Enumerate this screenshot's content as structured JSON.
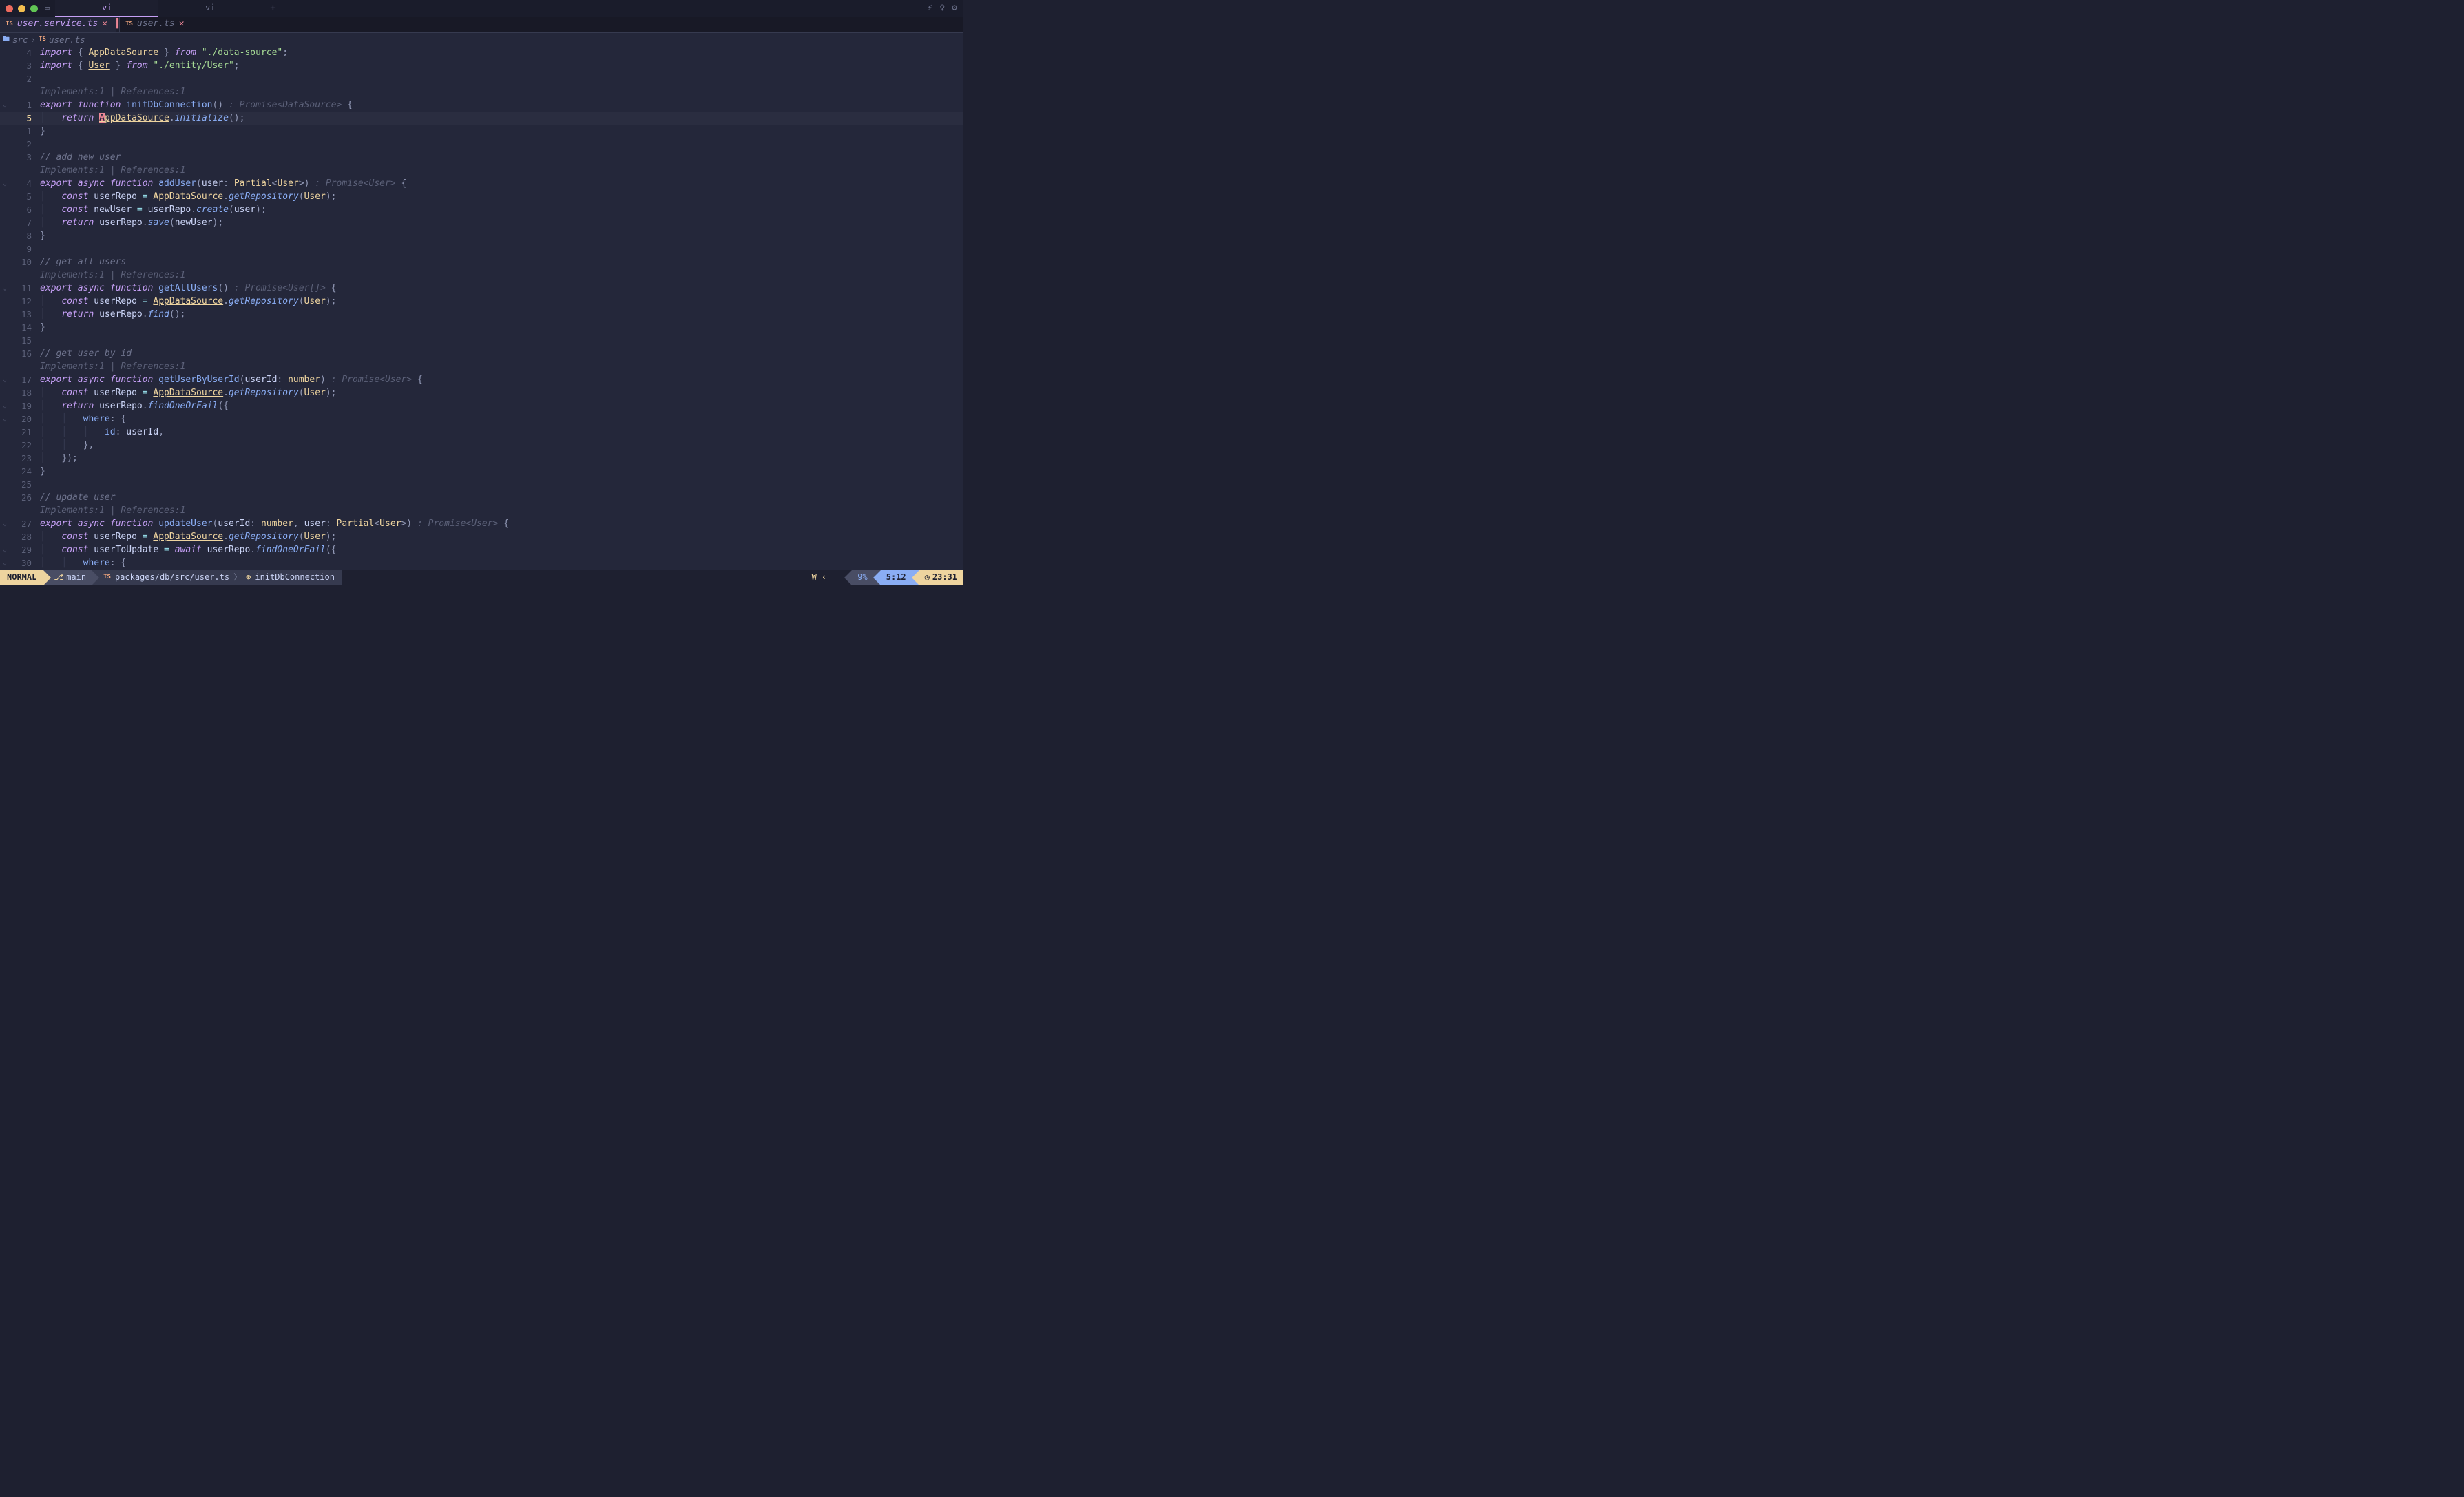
{
  "os": {
    "tabs": [
      {
        "label": "vi",
        "active": true
      },
      {
        "label": "vi",
        "active": false
      }
    ]
  },
  "ed_tabs": [
    {
      "index": "TS",
      "label": "user.service.ts",
      "close": "✕",
      "active": true,
      "cursor": true
    },
    {
      "index": "TS",
      "label": "user.ts",
      "close": "✕",
      "active": false
    }
  ],
  "winbar": {
    "root": "src",
    "file": "user.ts",
    "ts_badge": "TS"
  },
  "codelens_text": "Implements:1 | References:1",
  "code": {
    "lines": [
      {
        "g": "4",
        "fold": "",
        "html": "<span class='kw'>import</span> <span class='punct'>{</span> <span class='typeul'>AppDataSource</span> <span class='punct'>}</span> <span class='kw'>from</span> <span class='str'>\"./data-source\"</span><span class='punct'>;</span>"
      },
      {
        "g": "3",
        "fold": "",
        "html": "<span class='kw'>import</span> <span class='punct'>{</span> <span class='typeul'>User</span> <span class='punct'>}</span> <span class='kw'>from</span> <span class='str'>\"./entity/User\"</span><span class='punct'>;</span>"
      },
      {
        "g": "2",
        "fold": "",
        "html": ""
      },
      {
        "g": "",
        "fold": "",
        "html": "<span class='codelens'>Implements:1 | References:1</span>"
      },
      {
        "g": "1",
        "fold": "⌄",
        "html": "<span class='kw'>export</span> <span class='kw'>function</span> <span class='fn'>initDbConnection</span><span class='punct'>()</span> <span class='hint'>: Promise&lt;DataSource&gt;</span> <span class='punct'>{</span>"
      },
      {
        "g": "5",
        "fold": "",
        "cur": true,
        "html": "<span class='indent-guide'>│</span>   <span class='kw'>return</span> <span class='typeul'><span class='cursor-hl'>A</span>ppDataSource</span><span class='punct'>.</span><span class='fncall'>initialize</span><span class='punct'>();</span>"
      },
      {
        "g": "1",
        "fold": "",
        "html": "<span class='punct'>}</span>"
      },
      {
        "g": "2",
        "fold": "",
        "html": ""
      },
      {
        "g": "3",
        "fold": "",
        "html": "<span class='cmt'>// add new user</span>"
      },
      {
        "g": "",
        "fold": "",
        "html": "<span class='codelens'>Implements:1 | References:1</span>"
      },
      {
        "g": "4",
        "fold": "⌄",
        "html": "<span class='kw'>export</span> <span class='kw'>async</span> <span class='kw'>function</span> <span class='fn'>addUser</span><span class='punct'>(</span><span class='param'>user</span><span class='punct'>:</span> <span class='type'>Partial</span><span class='punct'>&lt;</span><span class='type'>User</span><span class='punct'>&gt;)</span> <span class='hint'>: Promise&lt;User&gt;</span> <span class='punct'>{</span>"
      },
      {
        "g": "5",
        "fold": "",
        "html": "<span class='indent-guide'>│</span>   <span class='kw'>const</span> <span class='ident'>userRepo</span> <span class='op'>=</span> <span class='typeul'>AppDataSource</span><span class='punct'>.</span><span class='fncall'>getRepository</span><span class='punct'>(</span><span class='type'>User</span><span class='punct'>);</span>"
      },
      {
        "g": "6",
        "fold": "",
        "html": "<span class='indent-guide'>│</span>   <span class='kw'>const</span> <span class='ident'>newUser</span> <span class='op'>=</span> <span class='ident'>userRepo</span><span class='punct'>.</span><span class='fncall'>create</span><span class='punct'>(</span><span class='ident'>user</span><span class='punct'>);</span>"
      },
      {
        "g": "7",
        "fold": "",
        "html": "<span class='indent-guide'>│</span>   <span class='kw'>return</span> <span class='ident'>userRepo</span><span class='punct'>.</span><span class='fncall'>save</span><span class='punct'>(</span><span class='ident'>newUser</span><span class='punct'>);</span>"
      },
      {
        "g": "8",
        "fold": "",
        "html": "<span class='punct'>}</span>"
      },
      {
        "g": "9",
        "fold": "",
        "html": ""
      },
      {
        "g": "10",
        "fold": "",
        "html": "<span class='cmt'>// get all users</span>"
      },
      {
        "g": "",
        "fold": "",
        "html": "<span class='codelens'>Implements:1 | References:1</span>"
      },
      {
        "g": "11",
        "fold": "⌄",
        "html": "<span class='kw'>export</span> <span class='kw'>async</span> <span class='kw'>function</span> <span class='fn'>getAllUsers</span><span class='punct'>()</span> <span class='hint'>: Promise&lt;User[]&gt;</span> <span class='punct'>{</span>"
      },
      {
        "g": "12",
        "fold": "",
        "html": "<span class='indent-guide'>│</span>   <span class='kw'>const</span> <span class='ident'>userRepo</span> <span class='op'>=</span> <span class='typeul'>AppDataSource</span><span class='punct'>.</span><span class='fncall'>getRepository</span><span class='punct'>(</span><span class='type'>User</span><span class='punct'>);</span>"
      },
      {
        "g": "13",
        "fold": "",
        "html": "<span class='indent-guide'>│</span>   <span class='kw'>return</span> <span class='ident'>userRepo</span><span class='punct'>.</span><span class='fncall'>find</span><span class='punct'>();</span>"
      },
      {
        "g": "14",
        "fold": "",
        "html": "<span class='punct'>}</span>"
      },
      {
        "g": "15",
        "fold": "",
        "html": ""
      },
      {
        "g": "16",
        "fold": "",
        "html": "<span class='cmt'>// get user by id</span>"
      },
      {
        "g": "",
        "fold": "",
        "html": "<span class='codelens'>Implements:1 | References:1</span>"
      },
      {
        "g": "17",
        "fold": "⌄",
        "html": "<span class='kw'>export</span> <span class='kw'>async</span> <span class='kw'>function</span> <span class='fn'>getUserByUserId</span><span class='punct'>(</span><span class='param'>userId</span><span class='punct'>:</span> <span class='type'>number</span><span class='punct'>)</span> <span class='hint'>: Promise&lt;User&gt;</span> <span class='punct'>{</span>"
      },
      {
        "g": "18",
        "fold": "",
        "html": "<span class='indent-guide'>│</span>   <span class='kw'>const</span> <span class='ident'>userRepo</span> <span class='op'>=</span> <span class='typeul'>AppDataSource</span><span class='punct'>.</span><span class='fncall'>getRepository</span><span class='punct'>(</span><span class='type'>User</span><span class='punct'>);</span>"
      },
      {
        "g": "19",
        "fold": "⌄",
        "html": "<span class='indent-guide'>│</span>   <span class='kw'>return</span> <span class='ident'>userRepo</span><span class='punct'>.</span><span class='fncall'>findOneOrFail</span><span class='punct'>({</span>"
      },
      {
        "g": "20",
        "fold": "⌄",
        "html": "<span class='indent-guide'>│</span>   <span class='indent-guide'>│</span>   <span class='prop'>where</span><span class='punct'>:</span> <span class='punct'>{</span>"
      },
      {
        "g": "21",
        "fold": "",
        "html": "<span class='indent-guide'>│</span>   <span class='indent-guide'>│</span>   <span class='indent-guide'>│</span>   <span class='prop'>id</span><span class='punct'>:</span> <span class='ident'>userId</span><span class='punct'>,</span>"
      },
      {
        "g": "22",
        "fold": "",
        "html": "<span class='indent-guide'>│</span>   <span class='indent-guide'>│</span>   <span class='punct'>},</span>"
      },
      {
        "g": "23",
        "fold": "",
        "html": "<span class='indent-guide'>│</span>   <span class='punct'>});</span>"
      },
      {
        "g": "24",
        "fold": "",
        "html": "<span class='punct'>}</span>"
      },
      {
        "g": "25",
        "fold": "",
        "html": ""
      },
      {
        "g": "26",
        "fold": "",
        "html": "<span class='cmt'>// update user</span>"
      },
      {
        "g": "",
        "fold": "",
        "html": "<span class='codelens'>Implements:1 | References:1</span>"
      },
      {
        "g": "27",
        "fold": "⌄",
        "html": "<span class='kw'>export</span> <span class='kw'>async</span> <span class='kw'>function</span> <span class='fn'>updateUser</span><span class='punct'>(</span><span class='param'>userId</span><span class='punct'>:</span> <span class='type'>number</span><span class='punct'>,</span> <span class='param'>user</span><span class='punct'>:</span> <span class='type'>Partial</span><span class='punct'>&lt;</span><span class='type'>User</span><span class='punct'>&gt;)</span> <span class='hint'>: Promise&lt;User&gt;</span> <span class='punct'>{</span>"
      },
      {
        "g": "28",
        "fold": "",
        "html": "<span class='indent-guide'>│</span>   <span class='kw'>const</span> <span class='ident'>userRepo</span> <span class='op'>=</span> <span class='typeul'>AppDataSource</span><span class='punct'>.</span><span class='fncall'>getRepository</span><span class='punct'>(</span><span class='type'>User</span><span class='punct'>);</span>"
      },
      {
        "g": "29",
        "fold": "⌄",
        "html": "<span class='indent-guide'>│</span>   <span class='kw'>const</span> <span class='ident'>userToUpdate</span> <span class='op'>=</span> <span class='kw'>await</span> <span class='ident'>userRepo</span><span class='punct'>.</span><span class='fncall'>findOneOrFail</span><span class='punct'>({</span>"
      },
      {
        "g": "30",
        "fold": "⌄",
        "html": "<span class='indent-guide'>│</span>   <span class='indent-guide'>│</span>   <span class='prop'>where</span><span class='punct'>:</span> <span class='punct'>{</span>"
      }
    ]
  },
  "status": {
    "mode": "NORMAL",
    "branch": "main",
    "path": "packages/db/src/user.ts",
    "func": "initDbConnection",
    "diag": "W",
    "percent": "9%",
    "pos": "5:12",
    "time": "23:31",
    "ts_badge": "TS"
  }
}
